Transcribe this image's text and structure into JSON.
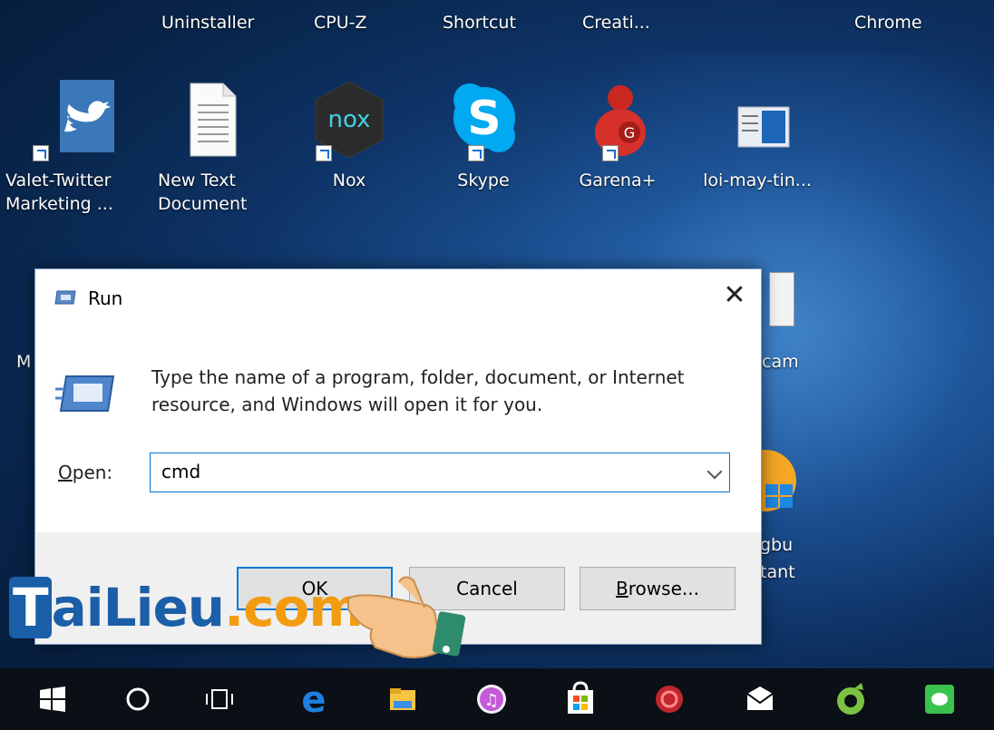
{
  "desktop": {
    "top_row_labels": [
      "Uninstaller",
      "CPU-Z",
      "Shortcut",
      "Creati...",
      "Chrome"
    ],
    "icons": [
      {
        "label": "Valet-Twitter\nMarketing ...",
        "icon": "twitter-bird-icon"
      },
      {
        "label": "New Text\nDocument",
        "icon": "text-document-icon"
      },
      {
        "label": "Nox",
        "icon": "nox-player-icon"
      },
      {
        "label": "Skype",
        "icon": "skype-icon"
      },
      {
        "label": "Garena+",
        "icon": "garena-icon"
      },
      {
        "label": "loi-may-tin...",
        "icon": "screenshot-file-icon"
      }
    ],
    "partial_labels": {
      "left_m": "M",
      "cam": "cam",
      "gbu": "gbu",
      "tant": "tant"
    }
  },
  "run_dialog": {
    "title": "Run",
    "close_glyph": "✕",
    "description": "Type the name of a program, folder, document, or Internet resource, and Windows will open it for you.",
    "open_label_prefix": "O",
    "open_label_rest": "pen:",
    "open_value": "cmd",
    "buttons": {
      "ok": "OK",
      "cancel": "Cancel",
      "browse_prefix": "B",
      "browse_rest": "rowse..."
    }
  },
  "watermark": {
    "part1": "T",
    "part2": "ai",
    "part3": "Lieu",
    "part4": ".com"
  },
  "taskbar": {
    "items": [
      "start-icon",
      "cortana-search-icon",
      "task-view-icon",
      "edge-icon",
      "file-explorer-icon",
      "itunes-icon",
      "store-icon",
      "antivirus-icon",
      "mail-icon",
      "coccoc-browser-icon",
      "line-app-icon"
    ]
  },
  "colors": {
    "accent": "#0078d7",
    "watermark_blue": "#1a5fa8",
    "watermark_orange": "#f39c12"
  }
}
